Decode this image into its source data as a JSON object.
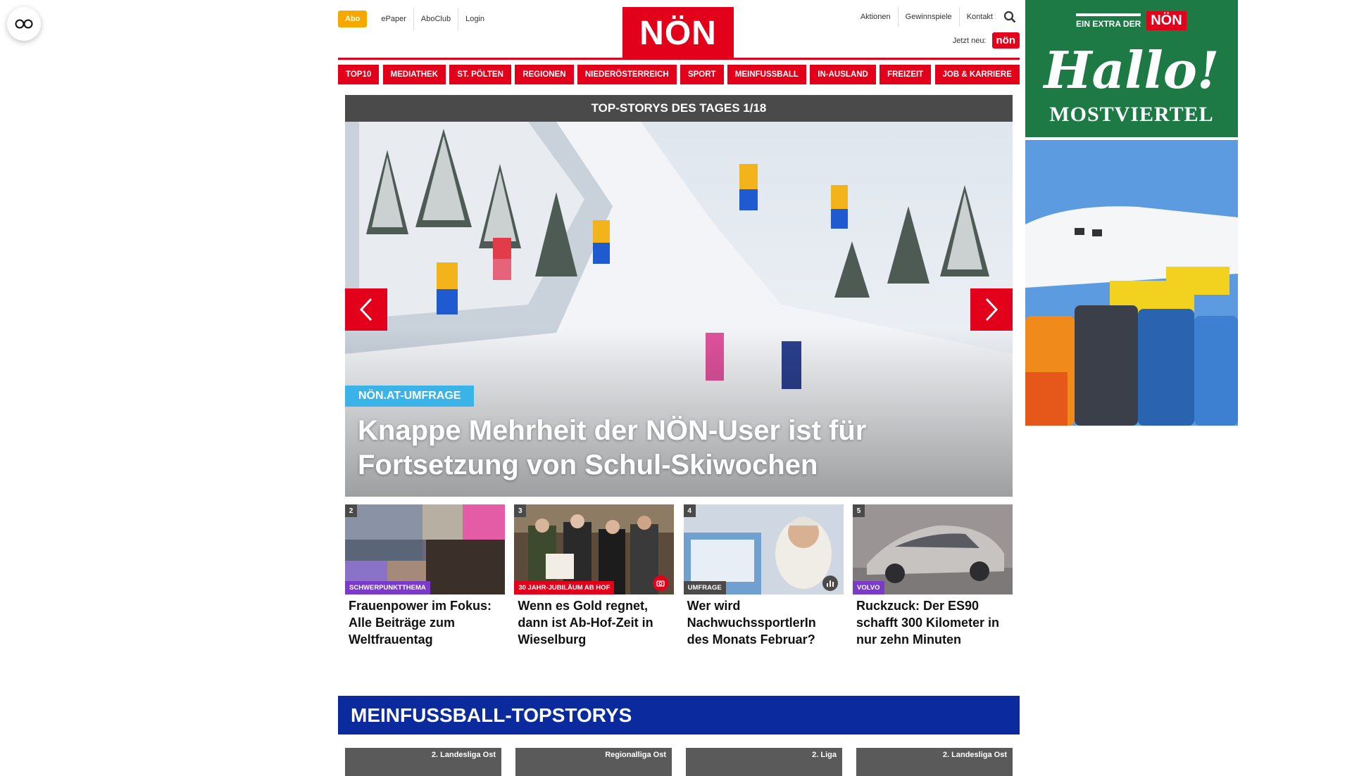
{
  "header": {
    "abo": "Abo",
    "left_links": [
      "ePaper",
      "AboClub",
      "Login"
    ],
    "logo": "NÖN",
    "right_links": [
      "Aktionen",
      "Gewinnspiele",
      "Kontakt"
    ],
    "jetzt_neu": "Jetzt neu:",
    "mini_logo": "nön"
  },
  "nav": [
    "TOP10",
    "MEDIATHEK",
    "ST. PÖLTEN",
    "REGIONEN",
    "NIEDERÖSTERREICH",
    "SPORT",
    "MEINFUSSBALL",
    "IN-AUSLAND",
    "FREIZEIT",
    "JOB & KARRIERE"
  ],
  "hero": {
    "header": "TOP-STORYS DES TAGES 1/18",
    "tag": "NÖN.AT-UMFRAGE",
    "title": "Knappe Mehrheit der NÖN-User ist für Fortsetzung von Schul-Skiwochen"
  },
  "teasers": [
    {
      "num": "2",
      "tag": "SCHWERPUNKTTHEMA",
      "tag_color": "#7a3cc8",
      "title": "Frauenpower im Fokus: Alle Beiträge zum Weltfrauentag"
    },
    {
      "num": "3",
      "tag": "30 JAHR-JUBILÄUM AB HOF",
      "tag_color": "#e2001a",
      "title": "Wenn es Gold regnet, dann ist Ab-Hof-Zeit in Wieselburg"
    },
    {
      "num": "4",
      "tag": "UMFRAGE",
      "tag_color": "#4a4a4a",
      "title": "Wer wird NachwuchssportlerIn des Monats Februar?"
    },
    {
      "num": "5",
      "tag": "VOLVO",
      "tag_color": "#7a3cc8",
      "title": "Ruckzuck: Der ES90 schafft 300 Kilometer in nur zehn Minuten"
    }
  ],
  "section": {
    "title": "MEINFUSSBALL-TOPSTORYS",
    "cards": [
      "2. Landesliga Ost",
      "Regionalliga Ost",
      "2. Liga",
      "2. Landesliga Ost"
    ]
  },
  "ads": {
    "extra_text": "EIN EXTRA DER",
    "extra_logo": "NÖN",
    "hallo": "Hallo!",
    "region": "MOSTVIERTEL"
  }
}
